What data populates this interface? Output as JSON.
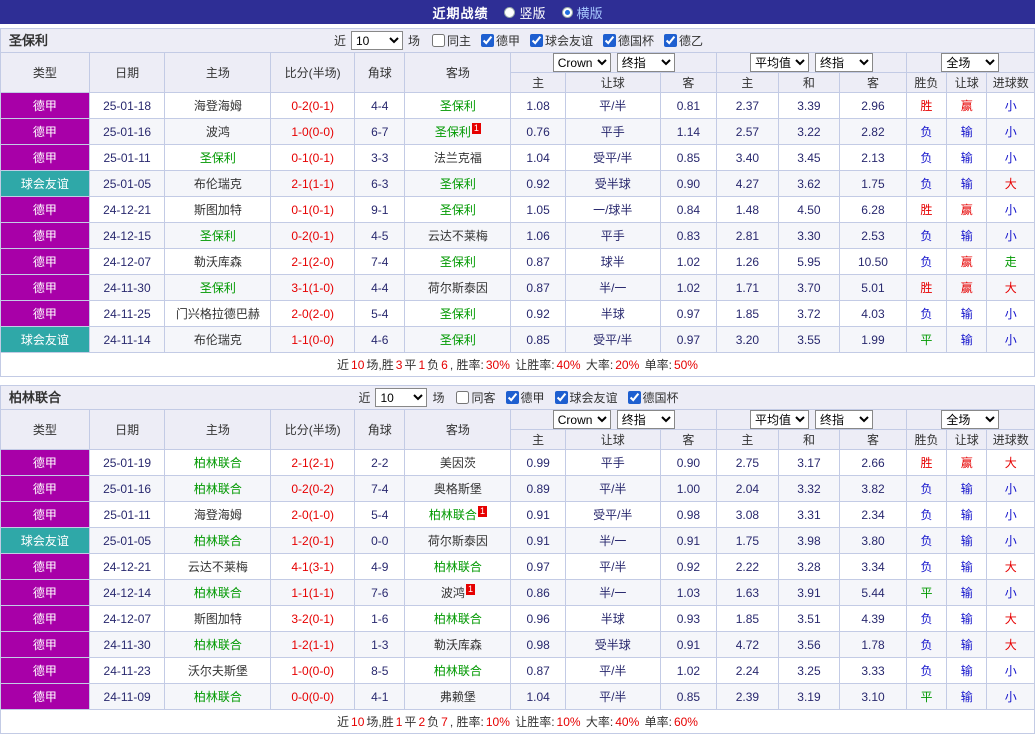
{
  "topbar": {
    "title": "近期战绩",
    "radios": [
      {
        "label": "竖版",
        "selected": false
      },
      {
        "label": "横版",
        "selected": true
      }
    ]
  },
  "header_template": {
    "count_prefix": "近",
    "count_suffix": "场",
    "static_cols": [
      "类型",
      "日期",
      "主场",
      "比分(半场)",
      "角球",
      "客场"
    ],
    "ah_selects": [
      "Crown",
      "终指"
    ],
    "eu_selects": [
      "平均值",
      "终指"
    ],
    "res_selects": [
      "全场"
    ],
    "sub_cols": [
      "主",
      "让球",
      "客",
      "主",
      "和",
      "客",
      "胜负",
      "让球",
      "进球数"
    ]
  },
  "colors": {
    "topbar_bg": "#2e2e95",
    "accent_red": "#e60000",
    "accent_blue": "#1414cc",
    "accent_green": "#009900",
    "header_bg": "#ededf6",
    "row_alt_bg": "#f5f6fa",
    "border": "#c3cbe5",
    "data_text": "#28286e",
    "league": {
      "德甲": "#a800a8",
      "球会友谊": "#2fa8a8"
    }
  },
  "tables": [
    {
      "team": "圣保利",
      "count": "10",
      "checkboxes": [
        {
          "label": "同主",
          "checked": false
        },
        {
          "label": "德甲",
          "checked": true
        },
        {
          "label": "球会友谊",
          "checked": true
        },
        {
          "label": "德国杯",
          "checked": true
        },
        {
          "label": "德乙",
          "checked": true
        }
      ],
      "rows": [
        {
          "league": "德甲",
          "date": "25-01-18",
          "home": {
            "name": "海登海姆",
            "green": false,
            "badge": ""
          },
          "score": "0-2(0-1)",
          "corners": "4-4",
          "away": {
            "name": "圣保利",
            "green": true,
            "badge": ""
          },
          "ah": [
            "1.08",
            "平/半",
            "0.81"
          ],
          "eu": [
            "2.37",
            "3.39",
            "2.96"
          ],
          "res": [
            [
              "胜",
              "r"
            ],
            [
              "赢",
              "r"
            ],
            [
              "小",
              "b"
            ]
          ]
        },
        {
          "league": "德甲",
          "date": "25-01-16",
          "home": {
            "name": "波鸿",
            "green": false,
            "badge": ""
          },
          "score": "1-0(0-0)",
          "corners": "6-7",
          "away": {
            "name": "圣保利",
            "green": true,
            "badge": "1"
          },
          "ah": [
            "0.76",
            "平手",
            "1.14"
          ],
          "eu": [
            "2.57",
            "3.22",
            "2.82"
          ],
          "res": [
            [
              "负",
              "b"
            ],
            [
              "输",
              "b"
            ],
            [
              "小",
              "b"
            ]
          ]
        },
        {
          "league": "德甲",
          "date": "25-01-11",
          "home": {
            "name": "圣保利",
            "green": true,
            "badge": ""
          },
          "score": "0-1(0-1)",
          "corners": "3-3",
          "away": {
            "name": "法兰克福",
            "green": false,
            "badge": ""
          },
          "ah": [
            "1.04",
            "受平/半",
            "0.85"
          ],
          "eu": [
            "3.40",
            "3.45",
            "2.13"
          ],
          "res": [
            [
              "负",
              "b"
            ],
            [
              "输",
              "b"
            ],
            [
              "小",
              "b"
            ]
          ]
        },
        {
          "league": "球会友谊",
          "date": "25-01-05",
          "home": {
            "name": "布伦瑞克",
            "green": false,
            "badge": ""
          },
          "score": "2-1(1-1)",
          "corners": "6-3",
          "away": {
            "name": "圣保利",
            "green": true,
            "badge": ""
          },
          "ah": [
            "0.92",
            "受半球",
            "0.90"
          ],
          "eu": [
            "4.27",
            "3.62",
            "1.75"
          ],
          "res": [
            [
              "负",
              "b"
            ],
            [
              "输",
              "b"
            ],
            [
              "大",
              "r"
            ]
          ]
        },
        {
          "league": "德甲",
          "date": "24-12-21",
          "home": {
            "name": "斯图加特",
            "green": false,
            "badge": ""
          },
          "score": "0-1(0-1)",
          "corners": "9-1",
          "away": {
            "name": "圣保利",
            "green": true,
            "badge": ""
          },
          "ah": [
            "1.05",
            "一/球半",
            "0.84"
          ],
          "eu": [
            "1.48",
            "4.50",
            "6.28"
          ],
          "res": [
            [
              "胜",
              "r"
            ],
            [
              "赢",
              "r"
            ],
            [
              "小",
              "b"
            ]
          ]
        },
        {
          "league": "德甲",
          "date": "24-12-15",
          "home": {
            "name": "圣保利",
            "green": true,
            "badge": ""
          },
          "score": "0-2(0-1)",
          "corners": "4-5",
          "away": {
            "name": "云达不莱梅",
            "green": false,
            "badge": ""
          },
          "ah": [
            "1.06",
            "平手",
            "0.83"
          ],
          "eu": [
            "2.81",
            "3.30",
            "2.53"
          ],
          "res": [
            [
              "负",
              "b"
            ],
            [
              "输",
              "b"
            ],
            [
              "小",
              "b"
            ]
          ]
        },
        {
          "league": "德甲",
          "date": "24-12-07",
          "home": {
            "name": "勒沃库森",
            "green": false,
            "badge": ""
          },
          "score": "2-1(2-0)",
          "corners": "7-4",
          "away": {
            "name": "圣保利",
            "green": true,
            "badge": ""
          },
          "ah": [
            "0.87",
            "球半",
            "1.02"
          ],
          "eu": [
            "1.26",
            "5.95",
            "10.50"
          ],
          "res": [
            [
              "负",
              "b"
            ],
            [
              "赢",
              "r"
            ],
            [
              "走",
              "g"
            ]
          ]
        },
        {
          "league": "德甲",
          "date": "24-11-30",
          "home": {
            "name": "圣保利",
            "green": true,
            "badge": ""
          },
          "score": "3-1(1-0)",
          "corners": "4-4",
          "away": {
            "name": "荷尔斯泰因",
            "green": false,
            "badge": ""
          },
          "ah": [
            "0.87",
            "半/一",
            "1.02"
          ],
          "eu": [
            "1.71",
            "3.70",
            "5.01"
          ],
          "res": [
            [
              "胜",
              "r"
            ],
            [
              "赢",
              "r"
            ],
            [
              "大",
              "r"
            ]
          ]
        },
        {
          "league": "德甲",
          "date": "24-11-25",
          "home": {
            "name": "门兴格拉德巴赫",
            "green": false,
            "badge": ""
          },
          "score": "2-0(2-0)",
          "corners": "5-4",
          "away": {
            "name": "圣保利",
            "green": true,
            "badge": ""
          },
          "ah": [
            "0.92",
            "半球",
            "0.97"
          ],
          "eu": [
            "1.85",
            "3.72",
            "4.03"
          ],
          "res": [
            [
              "负",
              "b"
            ],
            [
              "输",
              "b"
            ],
            [
              "小",
              "b"
            ]
          ]
        },
        {
          "league": "球会友谊",
          "date": "24-11-14",
          "home": {
            "name": "布伦瑞克",
            "green": false,
            "badge": ""
          },
          "score": "1-1(0-0)",
          "corners": "4-6",
          "away": {
            "name": "圣保利",
            "green": true,
            "badge": ""
          },
          "ah": [
            "0.85",
            "受平/半",
            "0.97"
          ],
          "eu": [
            "3.20",
            "3.55",
            "1.99"
          ],
          "res": [
            [
              "平",
              "g"
            ],
            [
              "输",
              "b"
            ],
            [
              "小",
              "b"
            ]
          ]
        }
      ],
      "footer": [
        [
          "近",
          "d"
        ],
        [
          "10",
          "r"
        ],
        [
          "场,胜",
          "d"
        ],
        [
          "3",
          "r"
        ],
        [
          "平",
          "d"
        ],
        [
          "1",
          "r"
        ],
        [
          "负",
          "d"
        ],
        [
          "6",
          "r"
        ],
        [
          ", 胜率:",
          "d"
        ],
        [
          "30%",
          "r"
        ],
        [
          " 让胜率:",
          "d"
        ],
        [
          "40%",
          "r"
        ],
        [
          " 大率:",
          "d"
        ],
        [
          "20%",
          "r"
        ],
        [
          " 单率:",
          "d"
        ],
        [
          "50%",
          "r"
        ]
      ]
    },
    {
      "team": "柏林联合",
      "count": "10",
      "checkboxes": [
        {
          "label": "同客",
          "checked": false
        },
        {
          "label": "德甲",
          "checked": true
        },
        {
          "label": "球会友谊",
          "checked": true
        },
        {
          "label": "德国杯",
          "checked": true
        }
      ],
      "rows": [
        {
          "league": "德甲",
          "date": "25-01-19",
          "home": {
            "name": "柏林联合",
            "green": true,
            "badge": ""
          },
          "score": "2-1(2-1)",
          "corners": "2-2",
          "away": {
            "name": "美因茨",
            "green": false,
            "badge": ""
          },
          "ah": [
            "0.99",
            "平手",
            "0.90"
          ],
          "eu": [
            "2.75",
            "3.17",
            "2.66"
          ],
          "res": [
            [
              "胜",
              "r"
            ],
            [
              "赢",
              "r"
            ],
            [
              "大",
              "r"
            ]
          ]
        },
        {
          "league": "德甲",
          "date": "25-01-16",
          "home": {
            "name": "柏林联合",
            "green": true,
            "badge": ""
          },
          "score": "0-2(0-2)",
          "corners": "7-4",
          "away": {
            "name": "奥格斯堡",
            "green": false,
            "badge": ""
          },
          "ah": [
            "0.89",
            "平/半",
            "1.00"
          ],
          "eu": [
            "2.04",
            "3.32",
            "3.82"
          ],
          "res": [
            [
              "负",
              "b"
            ],
            [
              "输",
              "b"
            ],
            [
              "小",
              "b"
            ]
          ]
        },
        {
          "league": "德甲",
          "date": "25-01-11",
          "home": {
            "name": "海登海姆",
            "green": false,
            "badge": ""
          },
          "score": "2-0(1-0)",
          "corners": "5-4",
          "away": {
            "name": "柏林联合",
            "green": true,
            "badge": "1"
          },
          "ah": [
            "0.91",
            "受平/半",
            "0.98"
          ],
          "eu": [
            "3.08",
            "3.31",
            "2.34"
          ],
          "res": [
            [
              "负",
              "b"
            ],
            [
              "输",
              "b"
            ],
            [
              "小",
              "b"
            ]
          ]
        },
        {
          "league": "球会友谊",
          "date": "25-01-05",
          "home": {
            "name": "柏林联合",
            "green": true,
            "badge": ""
          },
          "score": "1-2(0-1)",
          "corners": "0-0",
          "away": {
            "name": "荷尔斯泰因",
            "green": false,
            "badge": ""
          },
          "ah": [
            "0.91",
            "半/一",
            "0.91"
          ],
          "eu": [
            "1.75",
            "3.98",
            "3.80"
          ],
          "res": [
            [
              "负",
              "b"
            ],
            [
              "输",
              "b"
            ],
            [
              "小",
              "b"
            ]
          ]
        },
        {
          "league": "德甲",
          "date": "24-12-21",
          "home": {
            "name": "云达不莱梅",
            "green": false,
            "badge": ""
          },
          "score": "4-1(3-1)",
          "corners": "4-9",
          "away": {
            "name": "柏林联合",
            "green": true,
            "badge": ""
          },
          "ah": [
            "0.97",
            "平/半",
            "0.92"
          ],
          "eu": [
            "2.22",
            "3.28",
            "3.34"
          ],
          "res": [
            [
              "负",
              "b"
            ],
            [
              "输",
              "b"
            ],
            [
              "大",
              "r"
            ]
          ]
        },
        {
          "league": "德甲",
          "date": "24-12-14",
          "home": {
            "name": "柏林联合",
            "green": true,
            "badge": ""
          },
          "score": "1-1(1-1)",
          "corners": "7-6",
          "away": {
            "name": "波鸿",
            "green": false,
            "badge": "1"
          },
          "ah": [
            "0.86",
            "半/一",
            "1.03"
          ],
          "eu": [
            "1.63",
            "3.91",
            "5.44"
          ],
          "res": [
            [
              "平",
              "g"
            ],
            [
              "输",
              "b"
            ],
            [
              "小",
              "b"
            ]
          ]
        },
        {
          "league": "德甲",
          "date": "24-12-07",
          "home": {
            "name": "斯图加特",
            "green": false,
            "badge": ""
          },
          "score": "3-2(0-1)",
          "corners": "1-6",
          "away": {
            "name": "柏林联合",
            "green": true,
            "badge": ""
          },
          "ah": [
            "0.96",
            "半球",
            "0.93"
          ],
          "eu": [
            "1.85",
            "3.51",
            "4.39"
          ],
          "res": [
            [
              "负",
              "b"
            ],
            [
              "输",
              "b"
            ],
            [
              "大",
              "r"
            ]
          ]
        },
        {
          "league": "德甲",
          "date": "24-11-30",
          "home": {
            "name": "柏林联合",
            "green": true,
            "badge": ""
          },
          "score": "1-2(1-1)",
          "corners": "1-3",
          "away": {
            "name": "勒沃库森",
            "green": false,
            "badge": ""
          },
          "ah": [
            "0.98",
            "受半球",
            "0.91"
          ],
          "eu": [
            "4.72",
            "3.56",
            "1.78"
          ],
          "res": [
            [
              "负",
              "b"
            ],
            [
              "输",
              "b"
            ],
            [
              "大",
              "r"
            ]
          ]
        },
        {
          "league": "德甲",
          "date": "24-11-23",
          "home": {
            "name": "沃尔夫斯堡",
            "green": false,
            "badge": ""
          },
          "score": "1-0(0-0)",
          "corners": "8-5",
          "away": {
            "name": "柏林联合",
            "green": true,
            "badge": ""
          },
          "ah": [
            "0.87",
            "平/半",
            "1.02"
          ],
          "eu": [
            "2.24",
            "3.25",
            "3.33"
          ],
          "res": [
            [
              "负",
              "b"
            ],
            [
              "输",
              "b"
            ],
            [
              "小",
              "b"
            ]
          ]
        },
        {
          "league": "德甲",
          "date": "24-11-09",
          "home": {
            "name": "柏林联合",
            "green": true,
            "badge": ""
          },
          "score": "0-0(0-0)",
          "corners": "4-1",
          "away": {
            "name": "弗赖堡",
            "green": false,
            "badge": ""
          },
          "ah": [
            "1.04",
            "平/半",
            "0.85"
          ],
          "eu": [
            "2.39",
            "3.19",
            "3.10"
          ],
          "res": [
            [
              "平",
              "g"
            ],
            [
              "输",
              "b"
            ],
            [
              "小",
              "b"
            ]
          ]
        }
      ],
      "footer": [
        [
          "近",
          "d"
        ],
        [
          "10",
          "r"
        ],
        [
          "场,胜",
          "d"
        ],
        [
          "1",
          "r"
        ],
        [
          "平",
          "d"
        ],
        [
          "2",
          "r"
        ],
        [
          "负",
          "d"
        ],
        [
          "7",
          "r"
        ],
        [
          ", 胜率:",
          "d"
        ],
        [
          "10%",
          "r"
        ],
        [
          " 让胜率:",
          "d"
        ],
        [
          "10%",
          "r"
        ],
        [
          " 大率:",
          "d"
        ],
        [
          "40%",
          "r"
        ],
        [
          " 单率:",
          "d"
        ],
        [
          "60%",
          "r"
        ]
      ]
    }
  ]
}
